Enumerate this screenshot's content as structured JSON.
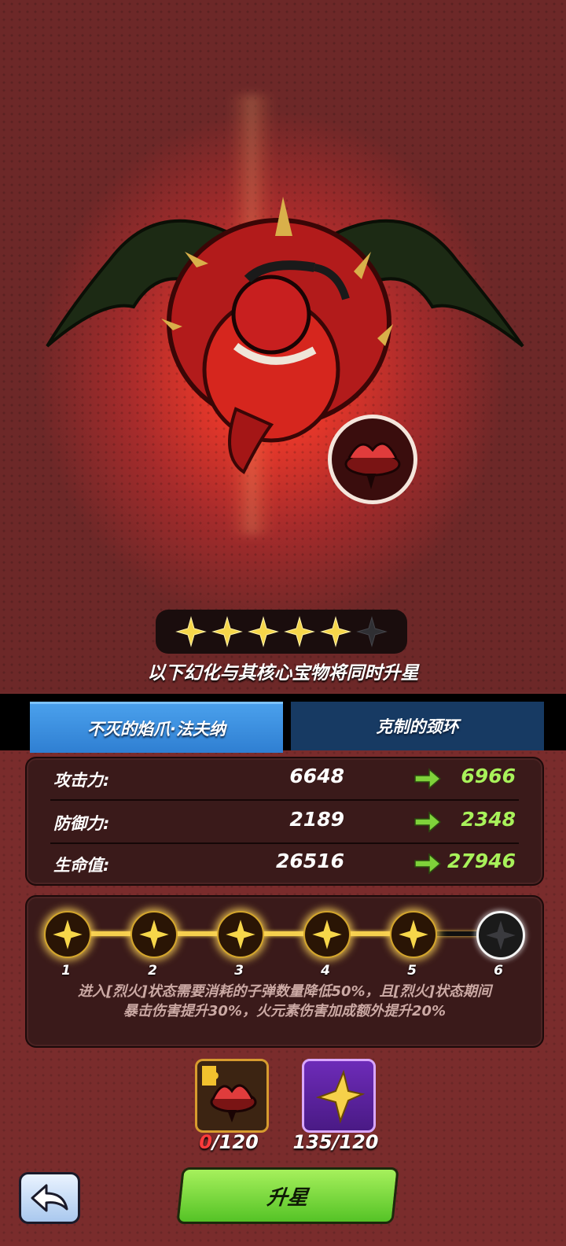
{
  "stars": {
    "filled": 5,
    "total": 6
  },
  "subtitle": "以下幻化与其核心宝物将同时升星",
  "tabs": [
    {
      "label": "不灭的焰爪·法夫纳",
      "active": true
    },
    {
      "label": "克制的颈环",
      "active": false
    }
  ],
  "stats": [
    {
      "label": "攻击力:",
      "old": "6648",
      "new": "6966"
    },
    {
      "label": "防御力:",
      "old": "2189",
      "new": "2348"
    },
    {
      "label": "生命值:",
      "old": "26516",
      "new": "27946"
    }
  ],
  "track": {
    "nodes": [
      "1",
      "2",
      "3",
      "4",
      "5",
      "6"
    ],
    "reached": 5,
    "description_line1": "进入[烈火]状态需要消耗的子弹数量降低50%，且[烈火]状态期间",
    "description_line2": "暴击伤害提升30%，火元素伤害加成额外提升20%"
  },
  "materials": [
    {
      "icon": "collar-fragment-icon",
      "have": "0",
      "need": "/120"
    },
    {
      "icon": "gold-star-icon",
      "have": "135",
      "need": "/120"
    }
  ],
  "buttons": {
    "upgrade": "升星"
  },
  "colors": {
    "accent_green": "#a8f25a",
    "tab_blue": "#3a90e0",
    "star_gold": "#f6d64a"
  }
}
